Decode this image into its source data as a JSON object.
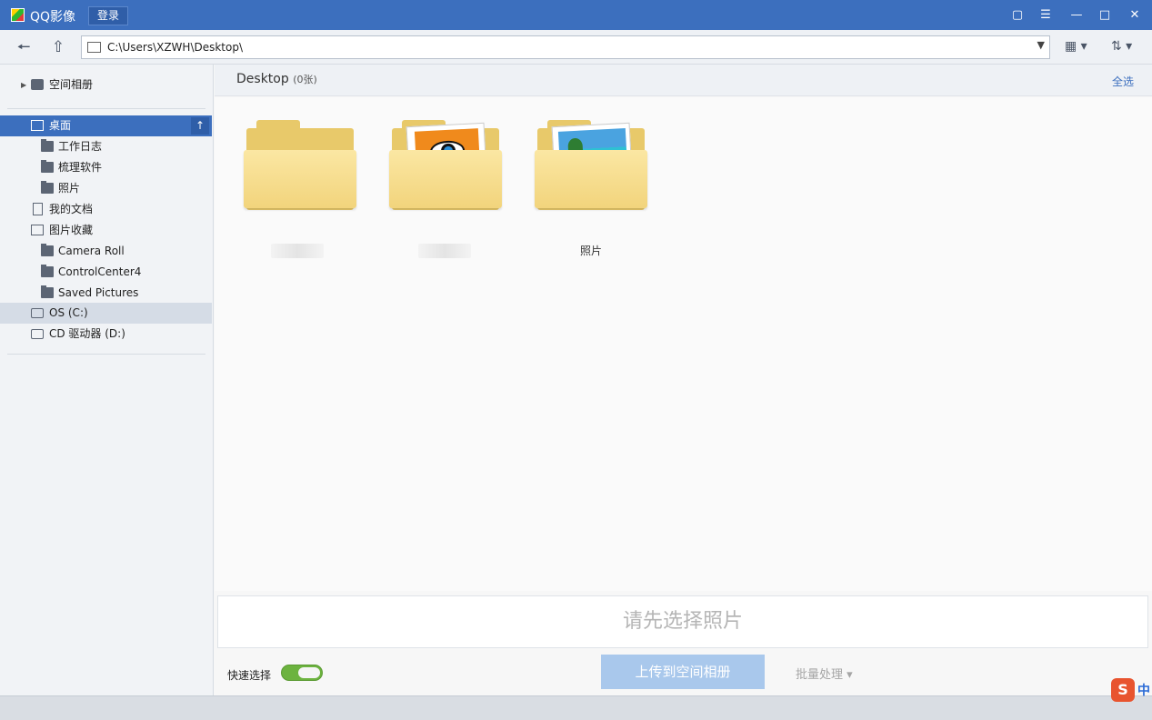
{
  "titlebar": {
    "app_title": "QQ影像",
    "login_label": "登录",
    "buttons": [
      "feedback-icon",
      "menu-icon",
      "minimize-icon",
      "maximize-icon",
      "close-icon"
    ]
  },
  "toolbar": {
    "path": "C:\\Users\\XZWH\\Desktop\\"
  },
  "sidebar": {
    "space_album": "空间相册",
    "desktop": "桌面",
    "desktop_children": [
      "工作日志",
      "梳理软件",
      "照片"
    ],
    "my_documents": "我的文档",
    "picture_collection": "图片收藏",
    "picture_children": [
      "Camera Roll",
      "ControlCenter4",
      "Saved Pictures"
    ],
    "drive_c": "OS (C:)",
    "drive_d": "CD 驱动器 (D:)"
  },
  "main": {
    "title": "Desktop",
    "count": "(0张)",
    "select_all": "全选",
    "folders": [
      {
        "label": "",
        "thumb": "plain-folder"
      },
      {
        "label": "",
        "thumb": "eye-image"
      },
      {
        "label": "照片",
        "thumb": "beach-image"
      }
    ]
  },
  "bottom": {
    "drop_hint": "请先选择照片",
    "quick_select": "快速选择",
    "quick_select_on": true,
    "upload_label": "上传到空间相册",
    "batch_label": "批量处理"
  },
  "ime": {
    "badge": "S",
    "label": "中"
  },
  "colors": {
    "accent": "#3c6fbe",
    "toggle_on": "#6cb33f",
    "upload_disabled": "#a9c8ec"
  }
}
